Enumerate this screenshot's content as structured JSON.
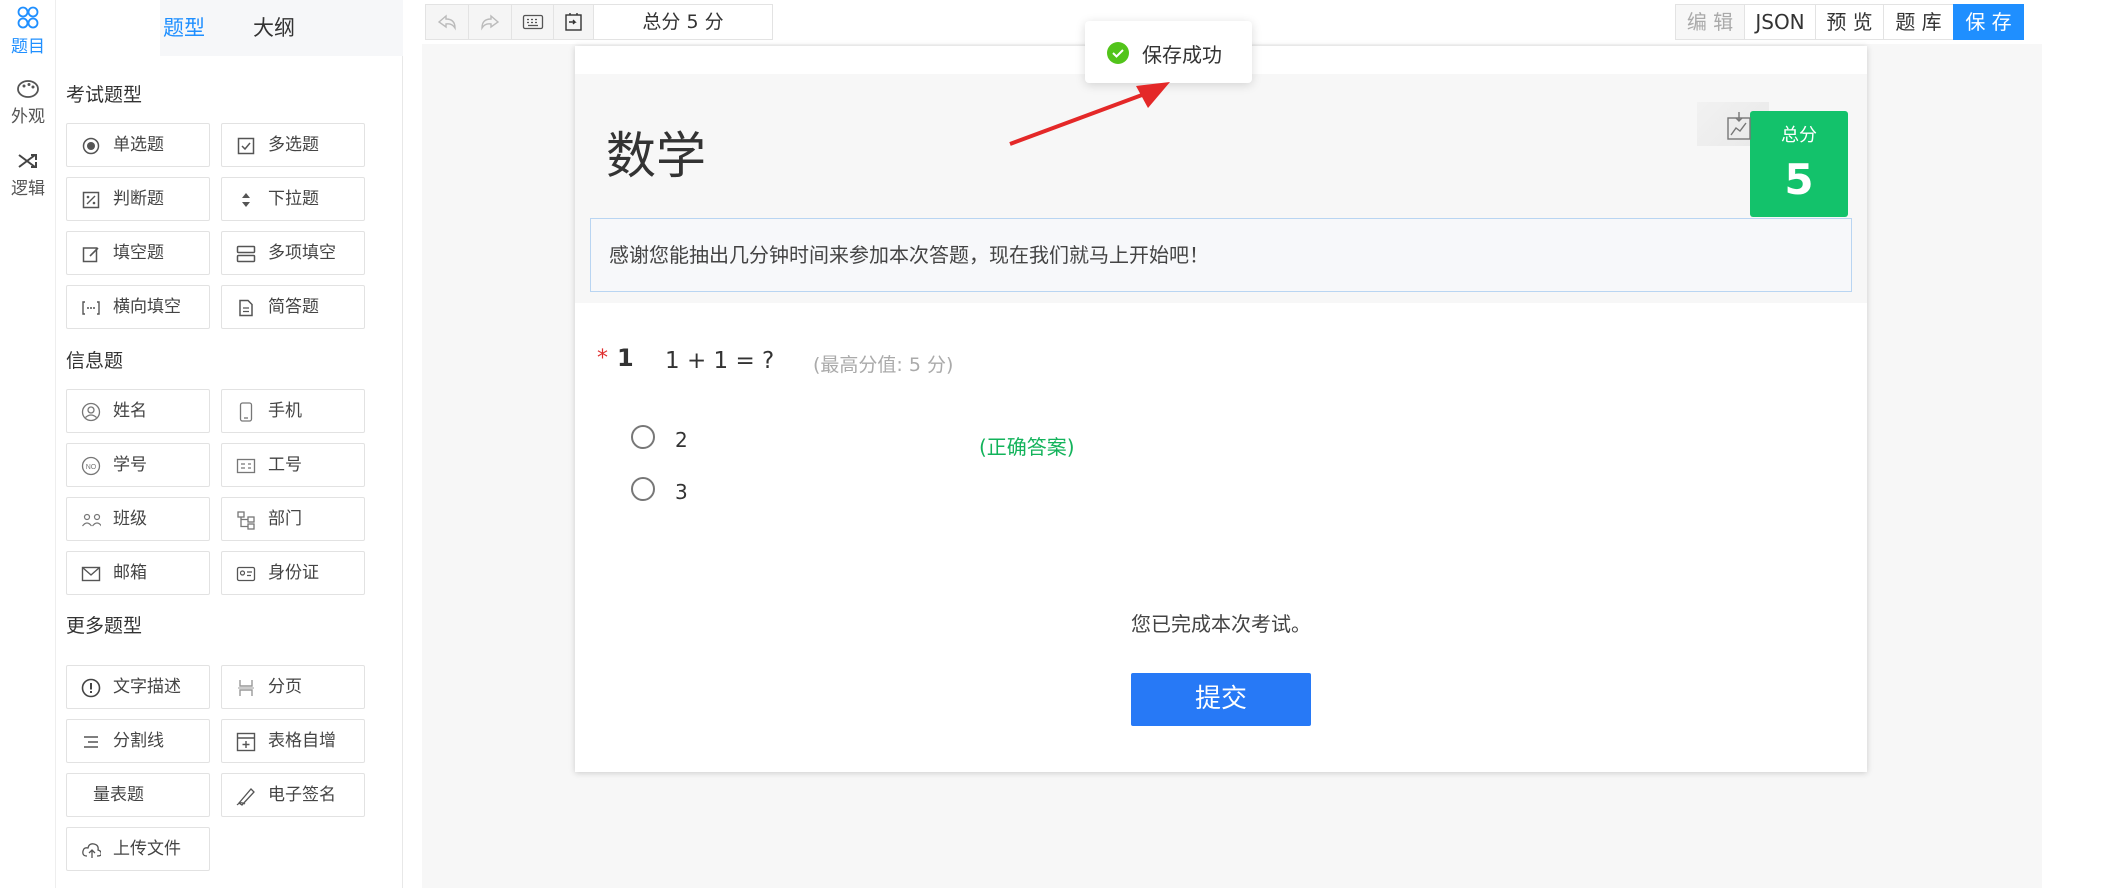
{
  "rail": {
    "items": [
      {
        "label": "题目",
        "icon": "questions-icon",
        "active": true
      },
      {
        "label": "外观",
        "icon": "palette-icon",
        "active": false
      },
      {
        "label": "逻辑",
        "icon": "shuffle-icon",
        "active": false
      }
    ]
  },
  "panel": {
    "tabs": [
      {
        "label": "题型",
        "active": true
      },
      {
        "label": "大纲",
        "active": false
      }
    ],
    "sections": [
      {
        "title": "考试题型",
        "items": [
          {
            "label": "单选题",
            "icon": "radio-icon"
          },
          {
            "label": "多选题",
            "icon": "checkbox-icon"
          },
          {
            "label": "判断题",
            "icon": "judge-icon"
          },
          {
            "label": "下拉题",
            "icon": "dropdown-icon"
          },
          {
            "label": "填空题",
            "icon": "edit-icon"
          },
          {
            "label": "多项填空",
            "icon": "multi-fill-icon"
          },
          {
            "label": "横向填空",
            "icon": "inline-fill-icon"
          },
          {
            "label": "简答题",
            "icon": "document-icon"
          }
        ]
      },
      {
        "title": "信息题",
        "items": [
          {
            "label": "姓名",
            "icon": "user-icon"
          },
          {
            "label": "手机",
            "icon": "phone-icon"
          },
          {
            "label": "学号",
            "icon": "student-no-icon"
          },
          {
            "label": "工号",
            "icon": "id-badge-icon"
          },
          {
            "label": "班级",
            "icon": "class-icon"
          },
          {
            "label": "部门",
            "icon": "org-chart-icon"
          },
          {
            "label": "邮箱",
            "icon": "mail-icon"
          },
          {
            "label": "身份证",
            "icon": "id-card-icon"
          }
        ]
      },
      {
        "title": "更多题型",
        "items": [
          {
            "label": "文字描述",
            "icon": "info-icon"
          },
          {
            "label": "分页",
            "icon": "page-break-icon"
          },
          {
            "label": "分割线",
            "icon": "divider-icon"
          },
          {
            "label": "表格自增",
            "icon": "table-add-icon"
          },
          {
            "label": "量表题",
            "icon": ""
          },
          {
            "label": "电子签名",
            "icon": "signature-icon"
          },
          {
            "label": "上传文件",
            "icon": "upload-cloud-icon"
          }
        ]
      }
    ]
  },
  "toolbar": {
    "total_score": "总分 5 分",
    "undo_icon": "undo-icon",
    "redo_icon": "redo-icon",
    "keyboard_icon": "keyboard-icon",
    "import_icon": "import-icon",
    "right_buttons": [
      {
        "label": "编 辑",
        "state": "disabled"
      },
      {
        "label": "JSON",
        "state": "normal"
      },
      {
        "label": "预 览",
        "state": "normal"
      },
      {
        "label": "题 库",
        "state": "normal"
      },
      {
        "label": "保 存",
        "state": "primary"
      }
    ]
  },
  "toast": {
    "text": "保存成功"
  },
  "paper": {
    "title": "数学",
    "description": "感谢您能抽出几分钟时间来参加本次答题，现在我们就马上开始吧！",
    "score_badge": {
      "label": "总分",
      "value": "5"
    },
    "question": {
      "required_mark": "*",
      "number": "1",
      "text": "1 + 1 = ?",
      "max_score": "(最高分值: 5 分)",
      "options": [
        {
          "text": "2",
          "tag": "(正确答案)"
        },
        {
          "text": "3",
          "tag": ""
        }
      ]
    },
    "finish_text": "您已完成本次考试。",
    "submit_label": "提交"
  },
  "colors": {
    "accent": "#1f8fff",
    "submit": "#2779f6",
    "score_badge": "#13c26b",
    "correct": "#13b35b",
    "required": "#e03030",
    "toast_ok": "#52c41a"
  }
}
